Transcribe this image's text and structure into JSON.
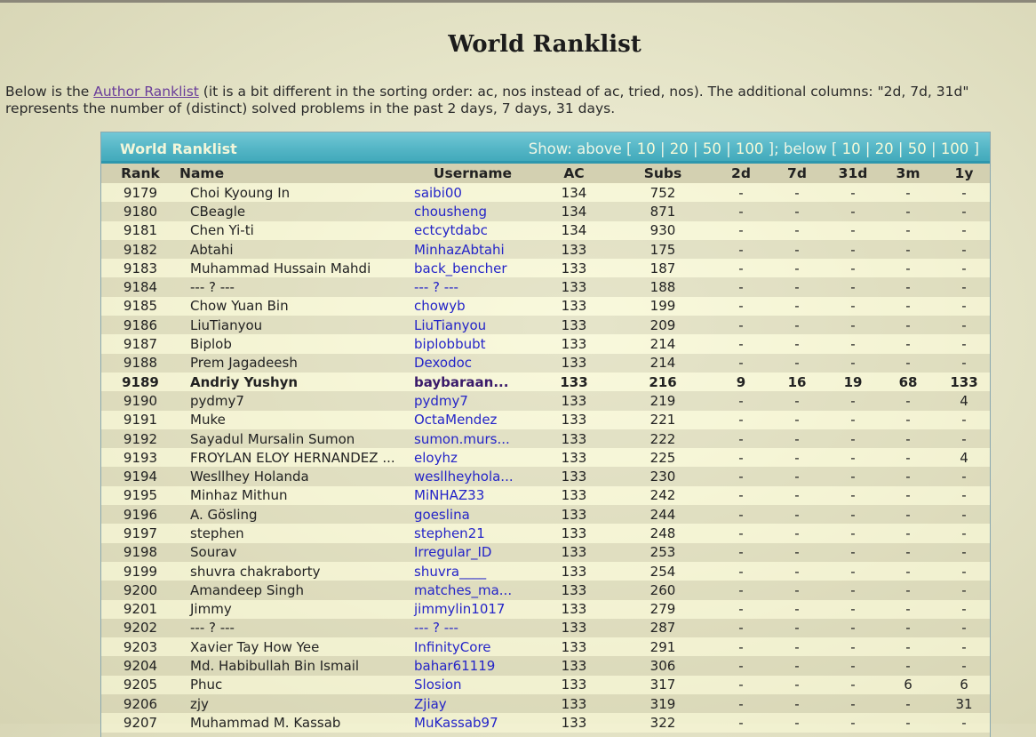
{
  "page": {
    "title": "World Ranklist",
    "intro_before": "Below is the ",
    "intro_link": "Author Ranklist",
    "intro_after": " (it is a bit different in the sorting order: ac, nos instead of ac, tried, nos). The additional columns: \"2d, 7d, 31d\" represents the number of (distinct) solved problems in the past 2 days, 7 days, 31 days."
  },
  "panel": {
    "title": "World Ranklist",
    "show_prefix": "Show: above [",
    "above": [
      "10",
      "20",
      "50",
      "100"
    ],
    "mid": "]; below [",
    "below": [
      "10",
      "20",
      "50",
      "100"
    ],
    "suffix": "]"
  },
  "table": {
    "columns": [
      "Rank",
      "Name",
      "Username",
      "AC",
      "Subs",
      "2d",
      "7d",
      "31d",
      "3m",
      "1y"
    ],
    "highlight_rank": "9189",
    "rows": [
      [
        "9179",
        "Choi Kyoung In",
        "saibi00",
        "134",
        "752",
        "-",
        "-",
        "-",
        "-",
        "-"
      ],
      [
        "9180",
        "CBeagle",
        "chousheng",
        "134",
        "871",
        "-",
        "-",
        "-",
        "-",
        "-"
      ],
      [
        "9181",
        "Chen Yi-ti",
        "ectcytdabc",
        "134",
        "930",
        "-",
        "-",
        "-",
        "-",
        "-"
      ],
      [
        "9182",
        "Abtahi",
        "MinhazAbtahi",
        "133",
        "175",
        "-",
        "-",
        "-",
        "-",
        "-"
      ],
      [
        "9183",
        "Muhammad Hussain Mahdi",
        "back_bencher",
        "133",
        "187",
        "-",
        "-",
        "-",
        "-",
        "-"
      ],
      [
        "9184",
        "--- ? ---",
        "--- ? ---",
        "133",
        "188",
        "-",
        "-",
        "-",
        "-",
        "-"
      ],
      [
        "9185",
        "Chow Yuan Bin",
        "chowyb",
        "133",
        "199",
        "-",
        "-",
        "-",
        "-",
        "-"
      ],
      [
        "9186",
        "LiuTianyou",
        "LiuTianyou",
        "133",
        "209",
        "-",
        "-",
        "-",
        "-",
        "-"
      ],
      [
        "9187",
        "Biplob",
        "biplobbubt",
        "133",
        "214",
        "-",
        "-",
        "-",
        "-",
        "-"
      ],
      [
        "9188",
        "Prem Jagadeesh",
        "Dexodoc",
        "133",
        "214",
        "-",
        "-",
        "-",
        "-",
        "-"
      ],
      [
        "9189",
        "Andriy Yushyn",
        "baybaraan...",
        "133",
        "216",
        "9",
        "16",
        "19",
        "68",
        "133"
      ],
      [
        "9190",
        "pydmy7",
        "pydmy7",
        "133",
        "219",
        "-",
        "-",
        "-",
        "-",
        "4"
      ],
      [
        "9191",
        "Muke",
        "OctaMendez",
        "133",
        "221",
        "-",
        "-",
        "-",
        "-",
        "-"
      ],
      [
        "9192",
        "Sayadul Mursalin Sumon",
        "sumon.murs...",
        "133",
        "222",
        "-",
        "-",
        "-",
        "-",
        "-"
      ],
      [
        "9193",
        "FROYLAN ELOY HERNANDEZ ...",
        "eloyhz",
        "133",
        "225",
        "-",
        "-",
        "-",
        "-",
        "4"
      ],
      [
        "9194",
        "Wesllhey Holanda",
        "wesllheyhola...",
        "133",
        "230",
        "-",
        "-",
        "-",
        "-",
        "-"
      ],
      [
        "9195",
        "Minhaz Mithun",
        "MiNHAZ33",
        "133",
        "242",
        "-",
        "-",
        "-",
        "-",
        "-"
      ],
      [
        "9196",
        "A. Gösling",
        "goeslina",
        "133",
        "244",
        "-",
        "-",
        "-",
        "-",
        "-"
      ],
      [
        "9197",
        "stephen",
        "stephen21",
        "133",
        "248",
        "-",
        "-",
        "-",
        "-",
        "-"
      ],
      [
        "9198",
        "Sourav",
        "Irregular_ID",
        "133",
        "253",
        "-",
        "-",
        "-",
        "-",
        "-"
      ],
      [
        "9199",
        "shuvra chakraborty",
        "shuvra____",
        "133",
        "254",
        "-",
        "-",
        "-",
        "-",
        "-"
      ],
      [
        "9200",
        "Amandeep Singh",
        "matches_ma...",
        "133",
        "260",
        "-",
        "-",
        "-",
        "-",
        "-"
      ],
      [
        "9201",
        "Jimmy",
        "jimmylin1017",
        "133",
        "279",
        "-",
        "-",
        "-",
        "-",
        "-"
      ],
      [
        "9202",
        "--- ? ---",
        "--- ? ---",
        "133",
        "287",
        "-",
        "-",
        "-",
        "-",
        "-"
      ],
      [
        "9203",
        "Xavier Tay How Yee",
        "InfinityCore",
        "133",
        "291",
        "-",
        "-",
        "-",
        "-",
        "-"
      ],
      [
        "9204",
        "Md. Habibullah Bin Ismail",
        "bahar61119",
        "133",
        "306",
        "-",
        "-",
        "-",
        "-",
        "-"
      ],
      [
        "9205",
        "Phuc",
        "Slosion",
        "133",
        "317",
        "-",
        "-",
        "-",
        "6",
        "6"
      ],
      [
        "9206",
        "zjy",
        "Zjiay",
        "133",
        "319",
        "-",
        "-",
        "-",
        "-",
        "31"
      ],
      [
        "9207",
        "Muhammad M. Kassab",
        "MuKassab97",
        "133",
        "322",
        "-",
        "-",
        "-",
        "-",
        "-"
      ]
    ]
  }
}
